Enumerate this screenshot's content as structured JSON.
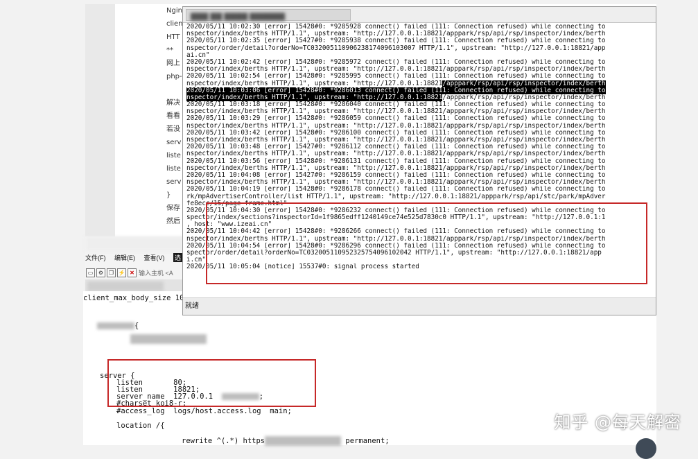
{
  "background_doc": {
    "lines": [
      "Ngin",
      "clien",
      "HTT",
      "**",
      "网上",
      "php-",
      "",
      "解决",
      "看看",
      "若没",
      "serv",
      "liste",
      "liste",
      "serv",
      "}",
      "保存",
      "然后"
    ]
  },
  "terminal": {
    "status_text": "就绪",
    "log_lines": [
      {
        "text": "2020/05/11 10:02:30 [error] 15428#0: *9285928 connect() failed (111: Connection refused) while connecting to"
      },
      {
        "text": "nspector/index/berths HTTP/1.1\", upstream: \"http://127.0.0.1:18821/apppark/rsp/api/rsp/inspector/index/berth"
      },
      {
        "text": "2020/05/11 10:02:35 [error] 15427#0: *9285938 connect() failed (111: Connection refused) while connecting to"
      },
      {
        "text": "nspector/order/detail?orderNo=TC032005110906238174096103007 HTTP/1.1\", upstream: \"http://127.0.0.1:18821/app"
      },
      {
        "text": "ai.cn\""
      },
      {
        "text": "2020/05/11 10:02:42 [error] 15428#0: *9285972 connect() failed (111: Connection refused) while connecting to"
      },
      {
        "text": "nspector/index/berths HTTP/1.1\", upstream: \"http://127.0.0.1:18821/apppark/rsp/api/rsp/inspector/index/berth"
      },
      {
        "text": "2020/05/11 10:02:54 [error] 15428#0: *9285995 connect() failed (111: Connection refused) while connecting to"
      },
      {
        "text": "nspector/index/berths HTTP/1.1\", upstream: \"http://127.0.0.1:18821",
        "highlight": "/apppark/rsp/api/rsp/inspector/index/berth"
      },
      {
        "text": "",
        "highlight": "2020/05/11 10:03:06 [error] 15428#0: *9286013 connect() failed (111: Connection refused) while connecting to"
      },
      {
        "text": "",
        "highlight": "nspector/index/berths HTTP/1.1\", upstream: \"http://127.0.0.1:18821",
        "rest": "/apppark/rsp/api/rsp/inspector/index/berth"
      },
      {
        "text": "2020/05/11 10:03:18 [error] 15428#0: *9286040 connect() failed (111: Connection refused) while connecting to"
      },
      {
        "text": "nspector/index/berths HTTP/1.1\", upstream: \"http://127.0.0.1:18821/apppark/rsp/api/rsp/inspector/index/berth"
      },
      {
        "text": "2020/05/11 10:03:29 [error] 15428#0: *9286059 connect() failed (111: Connection refused) while connecting to"
      },
      {
        "text": "nspector/index/berths HTTP/1.1\", upstream: \"http://127.0.0.1:18821/apppark/rsp/api/rsp/inspector/index/berth"
      },
      {
        "text": "2020/05/11 10:03:42 [error] 15428#0: *9286100 connect() failed (111: Connection refused) while connecting to"
      },
      {
        "text": "nspector/index/berths HTTP/1.1\", upstream: \"http://127.0.0.1:18821/apppark/rsp/api/rsp/inspector/index/berth"
      },
      {
        "text": "2020/05/11 10:03:48 [error] 15427#0: *9286112 connect() failed (111: Connection refused) while connecting to"
      },
      {
        "text": "nspector/index/berths HTTP/1.1\", upstream: \"http://127.0.0.1:18821/apppark/rsp/api/rsp/inspector/index/berth"
      },
      {
        "text": "2020/05/11 10:03:56 [error] 15428#0: *9286131 connect() failed (111: Connection refused) while connecting to"
      },
      {
        "text": "nspector/index/berths HTTP/1.1\", upstream: \"http://127.0.0.1:18821/apppark/rsp/api/rsp/inspector/index/berth"
      },
      {
        "text": "2020/05/11 10:04:08 [error] 15427#0: *9286159 connect() failed (111: Connection refused) while connecting to"
      },
      {
        "text": "nspector/index/berths HTTP/1.1\", upstream: \"http://127.0.0.1:18821/apppark/rsp/api/rsp/inspector/index/berth"
      },
      {
        "text": "2020/05/11 10:04:19 [error] 15428#0: *9286178 connect() failed (111: Connection refused) while connecting to"
      },
      {
        "text": "rk/mpAdvertiserController/list HTTP/1.1\", upstream: \"http://127.0.0.1:18821/apppark/rsp/api/stc/park/mpAdver"
      },
      {
        "text": "fe8ecc/15/page-frame.html\""
      },
      {
        "text": "2020/05/11 10:04:30 [error] 15428#0: *9286232 connect() failed (111: Connection refused) while connecting to"
      },
      {
        "text": "spector/index/sections?inspectorId=1f9865edff1240149ce74e525d7830c0 HTTP/1.1\", upstream: \"http://127.0.0.1:1"
      },
      {
        "text": ", host: \"www.izeai.cn\""
      },
      {
        "text": "2020/05/11 10:04:42 [error] 15428#0: *9286266 connect() failed (111: Connection refused) while connecting to"
      },
      {
        "text": "nspector/index/berths HTTP/1.1\", upstream: \"http://127.0.0.1:18821/apppark/rsp/api/rsp/inspector/index/berth"
      },
      {
        "text": "2020/05/11 10:04:54 [error] 15428#0: *9286296 connect() failed (111: Connection refused) while connecting to"
      },
      {
        "text": "spector/order/detail?orderNo=TC032005110952325754096102042 HTTP/1.1\", upstream: \"http://127.0.0.1:18821/app"
      },
      {
        "text": "i.cn\""
      },
      {
        "text": "2020/05/11 10:05:04 [notice] 15537#0: signal process started"
      }
    ]
  },
  "editor": {
    "menu": [
      "文件(F)",
      "编辑(E)",
      "查看(V)",
      "选"
    ],
    "host_label": "输入主机 <A",
    "code": {
      "top_line": "client_max_body_size 10",
      "block_open": "{",
      "server_open": "server {",
      "listen_1": "listen       80;",
      "listen_2": "listen       18821;",
      "server_name": "server_name  127.0.0.1",
      "server_name_end": ";",
      "charset": "#charset koi8-r;",
      "access_log": "#access_log  logs/host.access.log  main;",
      "location": "location /{",
      "rewrite": "rewrite ^(.*) https",
      "rewrite_end": " permanent;"
    }
  },
  "watermark": "知乎 @每天解密",
  "colors": {
    "annotation_red": "#c62828",
    "selection_bg": "#000000"
  }
}
